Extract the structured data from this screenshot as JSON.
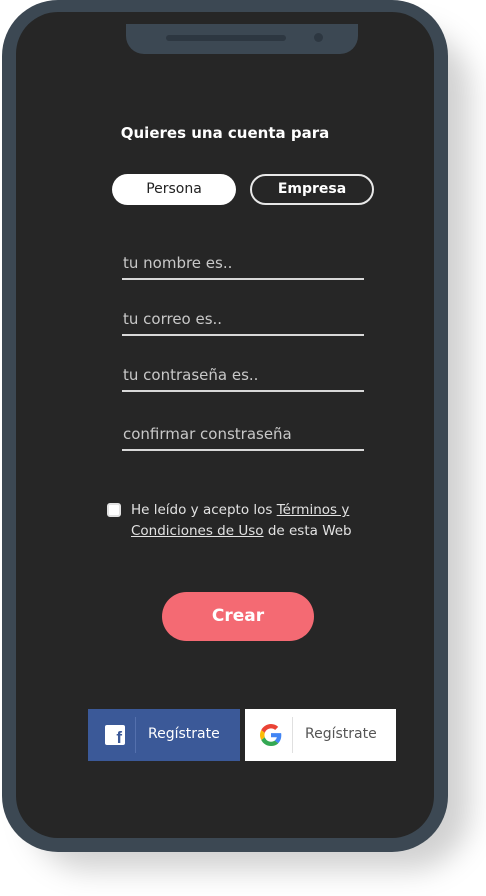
{
  "signup": {
    "title": "Quieres una cuenta para",
    "account_types": {
      "persona": "Persona",
      "empresa": "Empresa",
      "selected": "Persona"
    },
    "fields": {
      "name_placeholder": "tu nombre es..",
      "email_placeholder": "tu correo es..",
      "password_placeholder": "tu contraseña es..",
      "confirm_placeholder": "confirmar constraseña"
    },
    "terms": {
      "prefix": "He leído y acepto los",
      "link": "Términos y Condiciones de Uso",
      "suffix": "de esta Web",
      "checked": false
    },
    "submit_label": "Crear",
    "social": {
      "facebook_label": "Regístrate",
      "google_label": "Regístrate",
      "facebook_icon": "facebook-icon",
      "google_icon": "google-icon"
    },
    "colors": {
      "accent": "#f46a73",
      "facebook": "#3b5998",
      "background": "#262626",
      "frame": "#3c4853"
    }
  }
}
